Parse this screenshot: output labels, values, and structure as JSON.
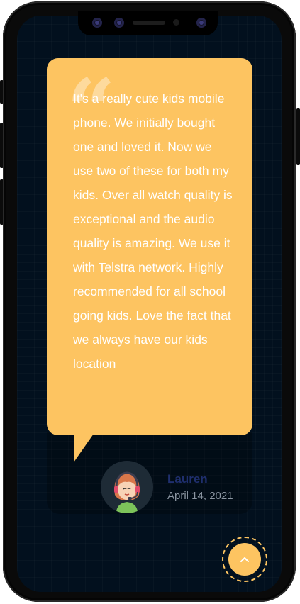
{
  "testimonial": {
    "quote": "It's a really cute kids mobile phone. We initially bought one and loved it. Now we use two of these for both my kids. Over all watch quality is exceptional and the audio quality is amazing. We use it with Telstra network. Highly recommended for all school going kids. Love the fact that we always have our kids location",
    "quote_mark": "“",
    "author": "Lauren",
    "date": "April 14, 2021"
  },
  "icons": {
    "quote": "quote-icon",
    "avatar": "girl-headset-avatar",
    "scroll": "chevron-up-icon"
  },
  "colors": {
    "accent": "#fdc461",
    "background": "#02101e",
    "author": "#1f2f6e",
    "date": "#8c96a2"
  }
}
